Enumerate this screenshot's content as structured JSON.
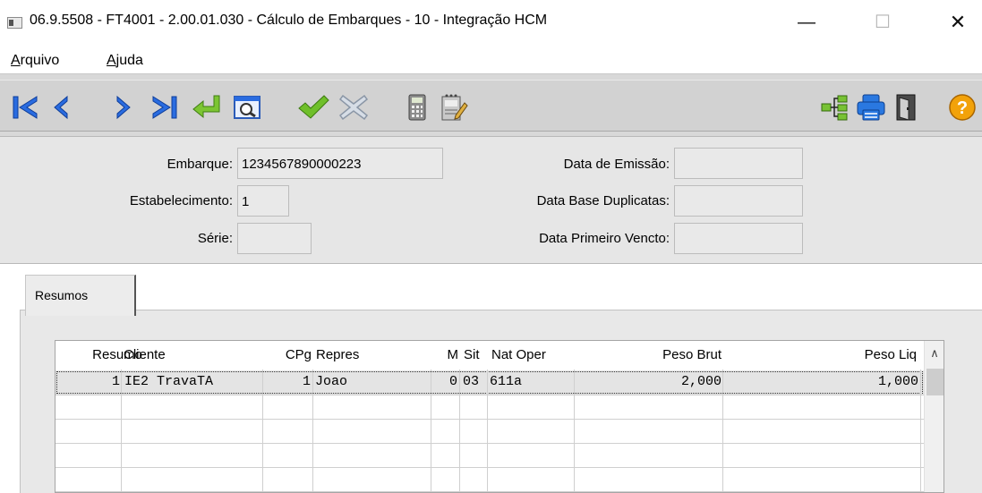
{
  "window": {
    "title": "06.9.5508 - FT4001 - 2.00.01.030 - Cálculo de Embarques - 10 - Integração HCM",
    "minimize": "—",
    "maximize": "☐",
    "close": "✕"
  },
  "menu": {
    "arquivo_hotkey": "A",
    "arquivo_rest": "rquivo",
    "ajuda_hotkey": "A",
    "ajuda_rest": "juda"
  },
  "toolbar": {
    "icons": [
      "first-icon",
      "previous-icon",
      "next-icon",
      "last-icon",
      "return-icon",
      "zoom-icon",
      "confirm-icon",
      "cancel-icon",
      "calculator-icon",
      "edit-notes-icon",
      "tree-icon",
      "print-icon",
      "exit-icon",
      "help-icon"
    ],
    "accent_blue": "#1f5fd8",
    "accent_green": "#6fbf2a",
    "help_orange": "#f2a20a",
    "help_label": "?"
  },
  "form": {
    "embarque_label": "Embarque:",
    "embarque_value": "1234567890000223",
    "estabelecimento_label": "Estabelecimento:",
    "estabelecimento_value": "1",
    "serie_label": "Série:",
    "serie_value": "",
    "data_emissao_label": "Data de Emissão:",
    "data_emissao_value": "",
    "data_base_label": "Data Base Duplicatas:",
    "data_base_value": "",
    "data_primeiro_label": "Data Primeiro Vencto:",
    "data_primeiro_value": ""
  },
  "tabs": [
    {
      "label": "Resumos",
      "active": true
    }
  ],
  "grid": {
    "columns": [
      "Resumo",
      "Cliente",
      "CPg",
      "Repres",
      "M",
      "Sit",
      "Nat Oper",
      "Peso Brut",
      "Peso Liq"
    ],
    "rows": [
      {
        "resumo": "1",
        "cliente": "IE2 TravaTA",
        "cpg": "1",
        "repres": "Joao",
        "m": "0",
        "sit": "03",
        "nat_oper": "611a",
        "peso_brut": "2,000",
        "peso_liq": "1,000"
      }
    ],
    "scroll_up": "∧"
  }
}
